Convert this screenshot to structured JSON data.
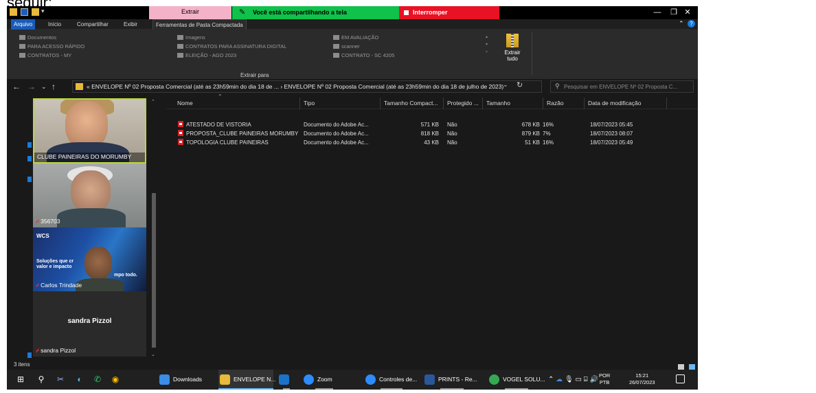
{
  "top_text": "seguir:",
  "titlebar": {
    "context_tab": "Extrair",
    "share_message": "Você está compartilhando a tela",
    "stop_share": "Interromper Compartilhamento",
    "minimize": "—",
    "maximize": "❐",
    "close": "✕"
  },
  "ribbon_tabs": {
    "arquivo": "Arquivo",
    "inicio": "Início",
    "compartilhar": "Compartilhar",
    "exibir": "Exibir",
    "ferramentas": "Ferramentas de Pasta Compactada",
    "collapse": "⌃",
    "help": "?"
  },
  "ribbon": {
    "col1": [
      "Documentos",
      "PARA ACESSO RÁPIDO",
      "CONTRATOS - MY"
    ],
    "col2": [
      "Imagens",
      "CONTRATOS PARA ASSINATURA DIGITAL",
      "ELEIÇÃO - AGO 2023"
    ],
    "col3": [
      "EM AVALIAÇÃO",
      "scanner",
      "CONTRATO - SC 4205"
    ],
    "extrair_tudo_line1": "Extrair",
    "extrair_tudo_line2": "tudo",
    "group_label": "Extrair para"
  },
  "address": {
    "path": "« ENVELOPE Nº 02 Proposta Comercial (até as 23h59min do dia 18 de ...  ›  ENVELOPE Nº 02 Proposta Comercial (até as 23h59min do dia 18 de julho de 2023)",
    "search_placeholder": "Pesquisar em ENVELOPE Nº 02 Proposta C..."
  },
  "columns": {
    "nome": "Nome",
    "tipo": "Tipo",
    "tamanho_compactado": "Tamanho Compact...",
    "protegido": "Protegido ...",
    "tamanho": "Tamanho",
    "razao": "Razão",
    "data": "Data de modificação"
  },
  "files": [
    {
      "name": "ATESTADO DE VISTORIA",
      "type": "Documento do Adobe Ac...",
      "compressed": "571 KB",
      "protected": "Não",
      "size": "678 KB",
      "ratio": "16%",
      "modified": "18/07/2023 05:45"
    },
    {
      "name": "PROPOSTA_CLUBE PAINEIRAS MORUMBY",
      "type": "Documento do Adobe Ac...",
      "compressed": "818 KB",
      "protected": "Não",
      "size": "879 KB",
      "ratio": "7%",
      "modified": "18/07/2023 08:07"
    },
    {
      "name": "TOPOLOGIA CLUBE PAINEIRAS",
      "type": "Documento do Adobe Ac...",
      "compressed": "43 KB",
      "protected": "Não",
      "size": "51 KB",
      "ratio": "16%",
      "modified": "18/07/2023 05:49"
    }
  ],
  "video": {
    "tile1_name": "CLUBE PAINEIRAS DO MORUMBY",
    "tile2_name": "356703",
    "tile3_name": "Carlos Trindade",
    "tile3_brand": "WCS",
    "tile3_slogan": "Soluções que cr valor e impacto",
    "tile3_slogan2": "mpo todo.",
    "tile4_center": "sandra Pizzol",
    "tile4_name": "sandra Pizzol"
  },
  "status": {
    "items": "3 itens"
  },
  "taskbar": {
    "apps": [
      {
        "label": "Downloads",
        "icon_color": "#3a8ee6"
      },
      {
        "label": "ENVELOPE N...",
        "icon_color": "#e8b93a"
      },
      {
        "label": "",
        "icon_color": "#1a73c9"
      },
      {
        "label": "Zoom",
        "icon_color": "#2d8cff"
      },
      {
        "label": "Controles de...",
        "icon_color": "#2d8cff"
      },
      {
        "label": "PRINTS - Re...",
        "icon_color": "#2b579a"
      },
      {
        "label": "VOGEL SOLU...",
        "icon_color": "#34a853"
      }
    ],
    "lang_line1": "POR",
    "lang_line2": "PTB",
    "time": "15:21",
    "date": "26/07/2023"
  },
  "colors": {
    "share_green": "#10c14b",
    "stop_red": "#e81224",
    "context_pink": "#f4b2c8",
    "active_speaker": "#b9d742",
    "pdf_red": "#d3232a"
  }
}
